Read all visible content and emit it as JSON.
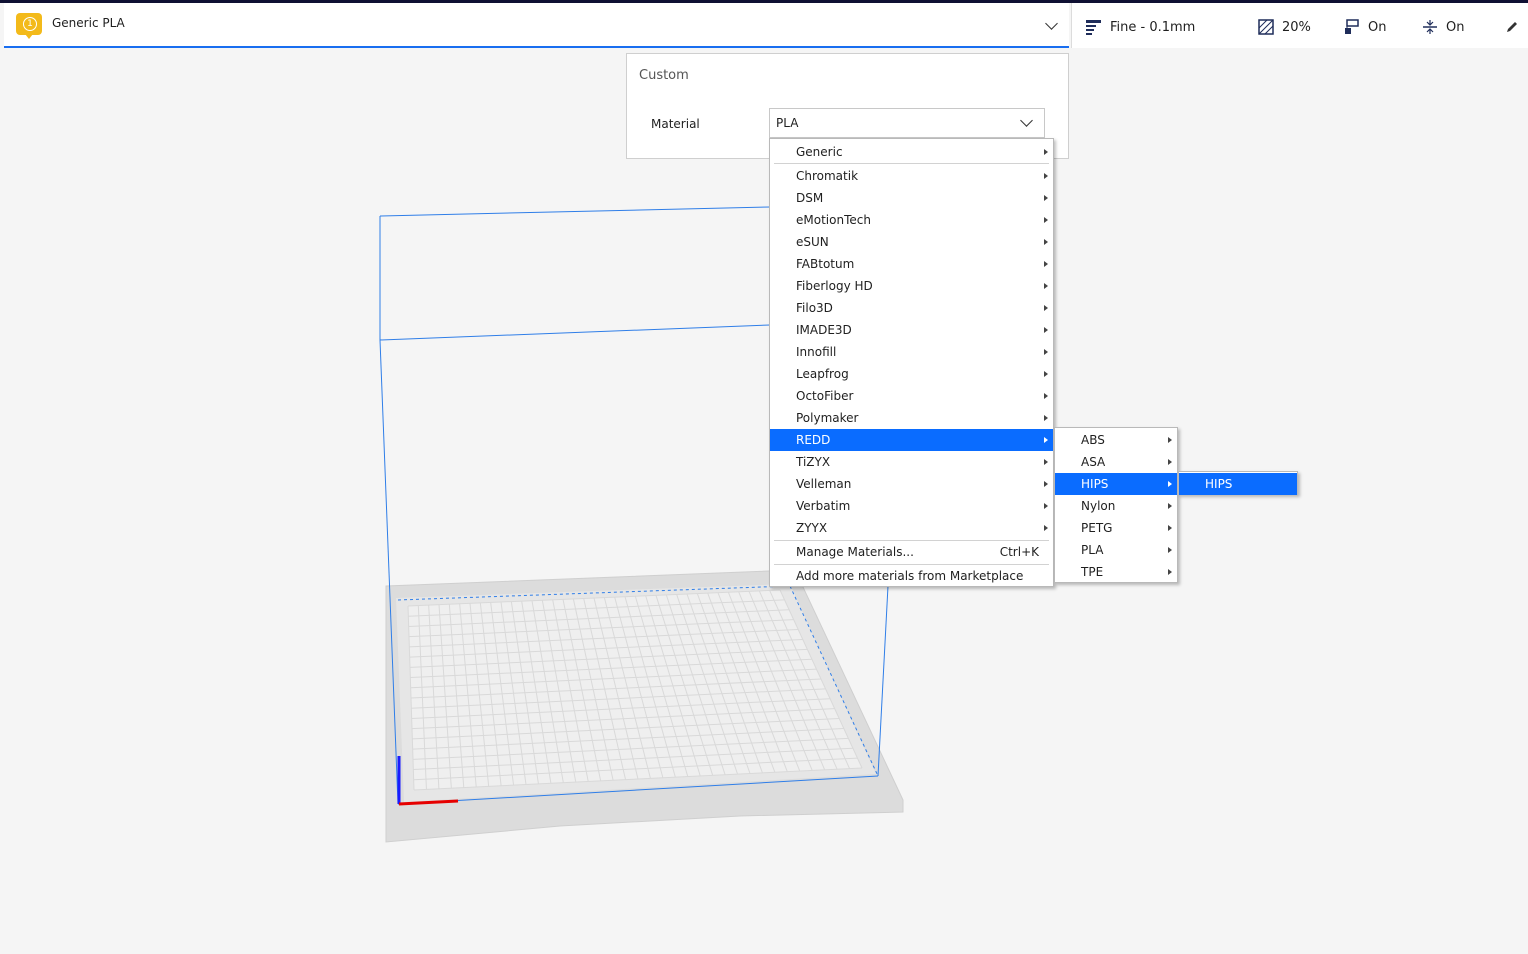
{
  "extruder": {
    "number": "1",
    "material_name": "Generic PLA"
  },
  "print_settings": {
    "profile": "Fine - 0.1mm",
    "infill": "20%",
    "support": "On",
    "adhesion": "On"
  },
  "panel": {
    "title": "Custom",
    "material_label": "Material",
    "material_value": "PLA"
  },
  "brand_menu": {
    "items": [
      "Generic",
      "Chromatik",
      "DSM",
      "eMotionTech",
      "eSUN",
      "FABtotum",
      "Fiberlogy HD",
      "Filo3D",
      "IMADE3D",
      "Innofill",
      "Leapfrog",
      "OctoFiber",
      "Polymaker",
      "REDD",
      "TiZYX",
      "Velleman",
      "Verbatim",
      "ZYYX"
    ],
    "highlighted": "REDD",
    "manage_label": "Manage Materials...",
    "manage_shortcut": "Ctrl+K",
    "marketplace_label": "Add more materials from Marketplace"
  },
  "type_menu": {
    "items": [
      "ABS",
      "ASA",
      "HIPS",
      "Nylon",
      "PETG",
      "PLA",
      "TPE"
    ],
    "highlighted": "HIPS"
  },
  "material_menu": {
    "items": [
      "HIPS"
    ],
    "highlighted": "HIPS"
  },
  "colors": {
    "accent": "#196ef0",
    "menu_highlight": "#0a6cff",
    "extruder_badge": "#f3ba1a"
  }
}
